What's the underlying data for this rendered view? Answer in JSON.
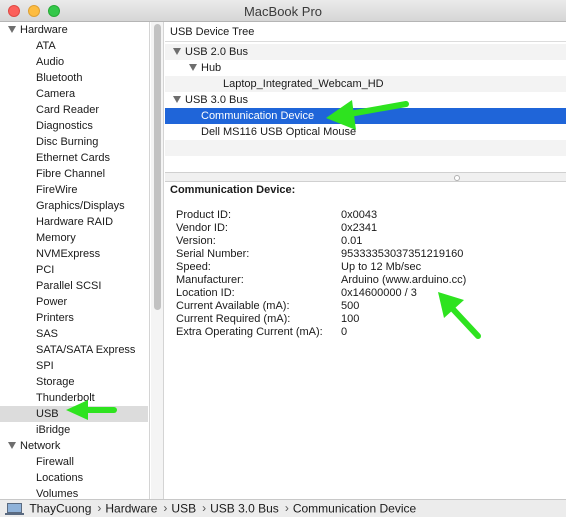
{
  "window": {
    "title": "MacBook Pro"
  },
  "sidebar": {
    "categories": [
      {
        "label": "Hardware",
        "items": [
          "ATA",
          "Audio",
          "Bluetooth",
          "Camera",
          "Card Reader",
          "Diagnostics",
          "Disc Burning",
          "Ethernet Cards",
          "Fibre Channel",
          "FireWire",
          "Graphics/Displays",
          "Hardware RAID",
          "Memory",
          "NVMExpress",
          "PCI",
          "Parallel SCSI",
          "Power",
          "Printers",
          "SAS",
          "SATA/SATA Express",
          "SPI",
          "Storage",
          "Thunderbolt",
          "USB",
          "iBridge"
        ]
      },
      {
        "label": "Network",
        "items": [
          "Firewall",
          "Locations",
          "Volumes"
        ]
      }
    ],
    "selected": "USB"
  },
  "tree": {
    "header": "USB Device Tree",
    "rows": [
      {
        "label": "USB 2.0 Bus",
        "level": 0,
        "expandable": true
      },
      {
        "label": "Hub",
        "level": 1,
        "expandable": true
      },
      {
        "label": "Laptop_Integrated_Webcam_HD",
        "level": 2,
        "expandable": false
      },
      {
        "label": "USB 3.0 Bus",
        "level": 0,
        "expandable": true
      },
      {
        "label": "Communication Device",
        "level": 1,
        "expandable": false,
        "selected": true
      },
      {
        "label": "Dell MS116 USB Optical Mouse",
        "level": 1,
        "expandable": false
      }
    ]
  },
  "detail": {
    "title": "Communication Device:",
    "properties": [
      {
        "label": "Product ID:",
        "value": "0x0043"
      },
      {
        "label": "Vendor ID:",
        "value": "0x2341"
      },
      {
        "label": "Version:",
        "value": "0.01"
      },
      {
        "label": "Serial Number:",
        "value": "95333353037351219160"
      },
      {
        "label": "Speed:",
        "value": "Up to 12 Mb/sec"
      },
      {
        "label": "Manufacturer:",
        "value": "Arduino (www.arduino.cc)"
      },
      {
        "label": "Location ID:",
        "value": "0x14600000 / 3"
      },
      {
        "label": "Current Available (mA):",
        "value": "500"
      },
      {
        "label": "Current Required (mA):",
        "value": "100"
      },
      {
        "label": "Extra Operating Current (mA):",
        "value": "0"
      }
    ]
  },
  "pathbar": {
    "icon": "computer-icon",
    "segments": [
      "ThayCuong",
      "Hardware",
      "USB",
      "USB 3.0 Bus",
      "Communication Device"
    ]
  },
  "colors": {
    "selection": "#1f65d9",
    "annotation_arrow": "#2ee31f"
  }
}
